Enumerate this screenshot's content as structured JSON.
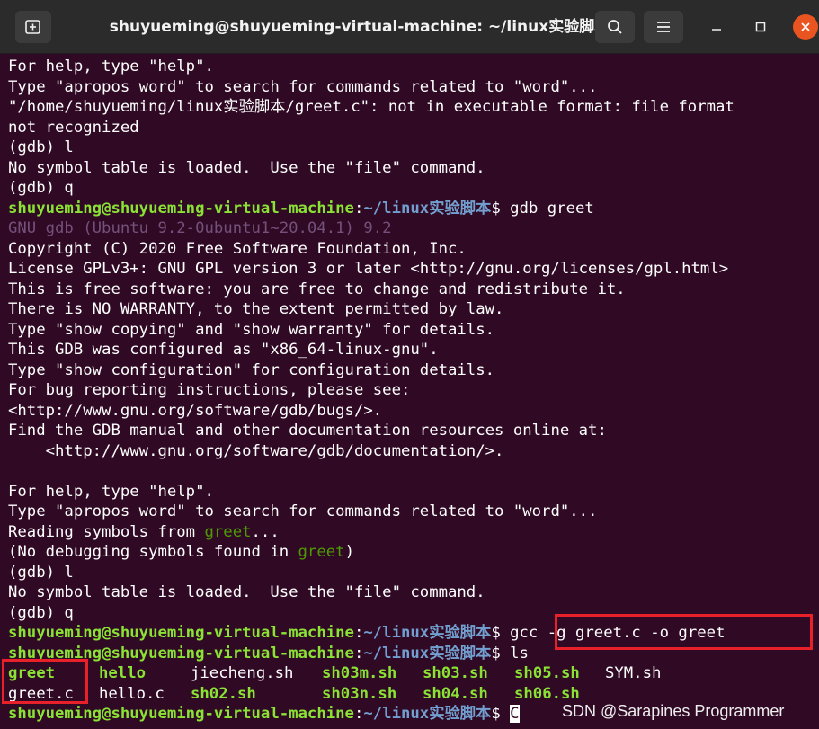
{
  "window": {
    "title": "shuyueming@shuyueming-virtual-machine: ~/linux实验脚本",
    "icons": {
      "new_tab": "new-tab-icon",
      "search": "search-icon",
      "menu": "hamburger-menu-icon",
      "minimize": "minimize-icon",
      "maximize": "maximize-icon",
      "close": "close-icon"
    },
    "colors": {
      "titlebar": "#2b2b2b",
      "close_button": "#e95420"
    }
  },
  "terminal": {
    "colors": {
      "background": "#300a24",
      "text": "#ffffff",
      "user_host": "#8ae234",
      "path": "#729fcf",
      "gdb_version": "#75507b",
      "program_name": "#4e9a06",
      "highlight_box": "#e8202a"
    },
    "prompt": {
      "user_host": "shuyueming@shuyueming-virtual-machine",
      "separator": ":",
      "path": "~/linux实验脚本",
      "symbol": "$"
    },
    "lines": {
      "l1": "For help, type \"help\".",
      "l2": "Type \"apropos word\" to search for commands related to \"word\"...",
      "l3": "\"/home/shuyueming/linux实验脚本/greet.c\": not in executable format: file format",
      "l4": "not recognized",
      "l5": "(gdb) l",
      "l6": "No symbol table is loaded.  Use the \"file\" command.",
      "l7": "(gdb) q",
      "cmd_gdb": " gdb greet",
      "l9": "GNU gdb (Ubuntu 9.2-0ubuntu1~20.04.1) 9.2",
      "l10": "Copyright (C) 2020 Free Software Foundation, Inc.",
      "l11": "License GPLv3+: GNU GPL version 3 or later <http://gnu.org/licenses/gpl.html>",
      "l12": "This is free software: you are free to change and redistribute it.",
      "l13": "There is NO WARRANTY, to the extent permitted by law.",
      "l14": "Type \"show copying\" and \"show warranty\" for details.",
      "l15": "This GDB was configured as \"x86_64-linux-gnu\".",
      "l16": "Type \"show configuration\" for configuration details.",
      "l17": "For bug reporting instructions, please see:",
      "l18": "<http://www.gnu.org/software/gdb/bugs/>.",
      "l19": "Find the GDB manual and other documentation resources online at:",
      "l20": "    <http://www.gnu.org/software/gdb/documentation/>.",
      "l22": "For help, type \"help\".",
      "l23": "Type \"apropos word\" to search for commands related to \"word\"...",
      "l24_a": "Reading symbols from ",
      "l24_prog": "greet",
      "l24_b": "...",
      "l25_a": "(No debugging symbols found in ",
      "l25_prog": "greet",
      "l25_b": ")",
      "l26": "(gdb) l",
      "l27": "No symbol table is loaded.  Use the \"file\" command.",
      "l28": "(gdb) q",
      "cmd_gcc": " gcc -g greet.c -o greet",
      "cmd_ls": " ls",
      "cursor_char": "C"
    },
    "ls_output": {
      "greet": "greet",
      "hello": "hello",
      "jiecheng": "jiecheng.sh",
      "sh03m": "sh03m.sh",
      "sh03": "sh03.sh",
      "sh05": "sh05.sh",
      "SYM": "SYM.sh",
      "greet_c": "greet.c",
      "hello_c": "hello.c",
      "sh02": "sh02.sh",
      "sh03n": "sh03n.sh",
      "sh04": "sh04.sh",
      "sh06": "sh06.sh"
    }
  },
  "watermark": "SDN @Sarapines Programmer"
}
